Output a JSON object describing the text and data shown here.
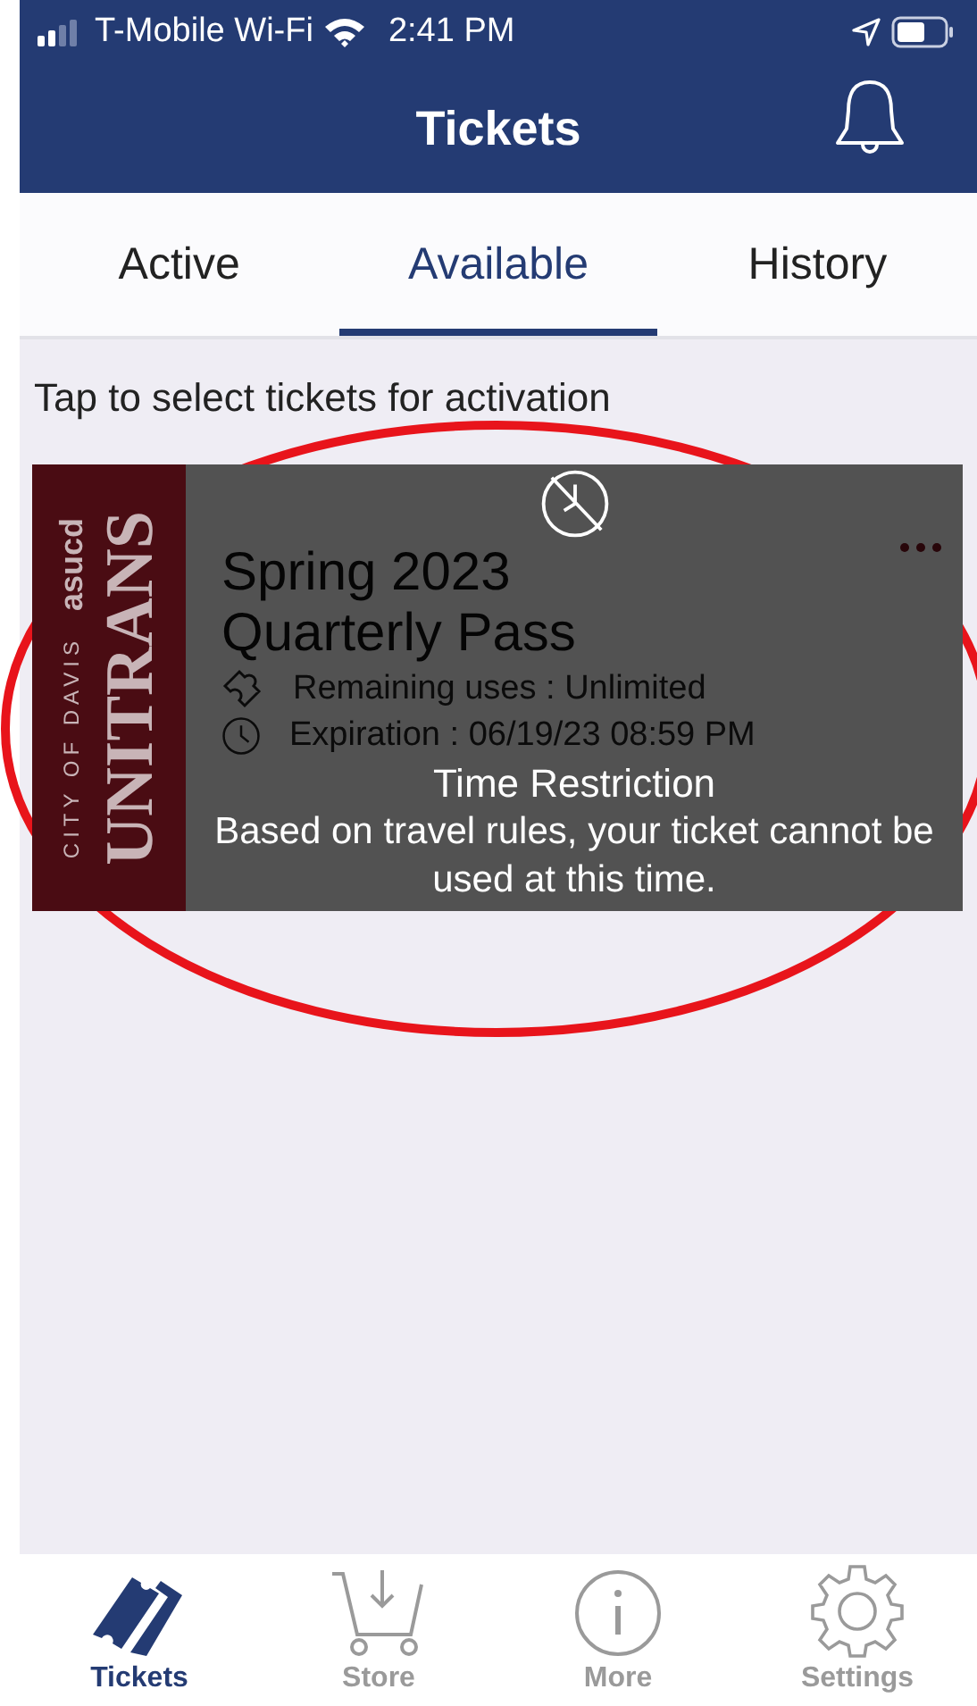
{
  "status_bar": {
    "carrier": "T-Mobile Wi-Fi",
    "time": "2:41 PM"
  },
  "header": {
    "title": "Tickets"
  },
  "tabs": [
    {
      "label": "Active",
      "selected": false
    },
    {
      "label": "Available",
      "selected": true
    },
    {
      "label": "History",
      "selected": false
    }
  ],
  "instruction": "Tap to select tickets for activation",
  "ticket": {
    "logo_city": "CITY OF DAVIS",
    "logo_name": "UNITRANS",
    "logo_org": "asucd",
    "title_lines": [
      "Spring 2023",
      "Quarterly Pass"
    ],
    "remaining_uses": "Remaining uses : Unlimited",
    "expiration": "Expiration : 06/19/23 08:59 PM"
  },
  "toast": {
    "title": "Time Restriction",
    "message": "Based on travel rules, your ticket cannot be used at this time."
  },
  "bottom_nav": [
    {
      "label": "Tickets",
      "kind": "tickets",
      "selected": true
    },
    {
      "label": "Store",
      "kind": "store",
      "selected": false
    },
    {
      "label": "More",
      "kind": "more",
      "selected": false
    },
    {
      "label": "Settings",
      "kind": "settings",
      "selected": false
    }
  ]
}
